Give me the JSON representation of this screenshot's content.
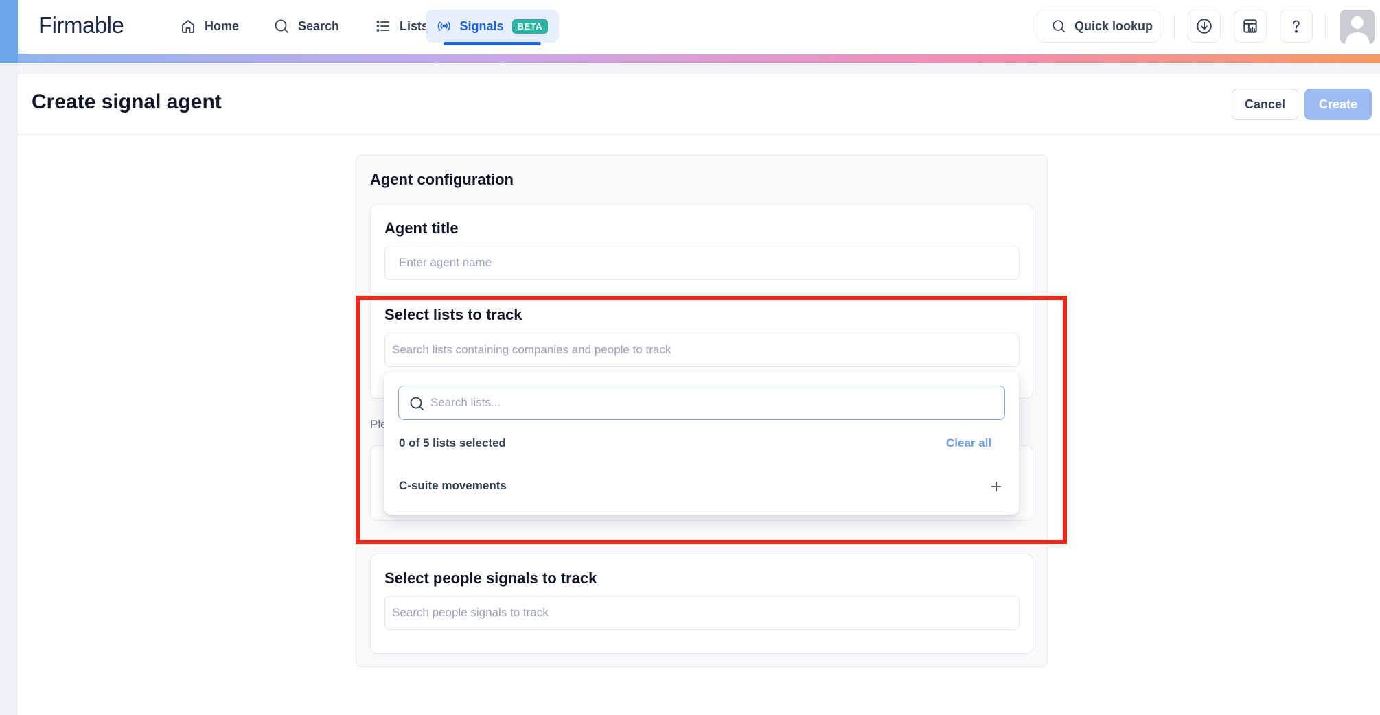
{
  "app": {
    "logo": "Firmable"
  },
  "nav": {
    "home": "Home",
    "search": "Search",
    "lists": "Lists",
    "signals": "Signals",
    "signals_badge": "BETA",
    "quick_lookup": "Quick lookup"
  },
  "header": {
    "title": "Create signal agent",
    "cancel": "Cancel",
    "create": "Create"
  },
  "config": {
    "title": "Agent configuration",
    "agent_title": {
      "label": "Agent title",
      "placeholder": "Enter agent name"
    },
    "lists": {
      "label": "Select lists to track",
      "placeholder": "Search lists containing companies and people to track"
    },
    "hint_partial": "Ple",
    "people_signals": {
      "label": "Select people signals to track",
      "placeholder": "Search people signals to track"
    }
  },
  "dropdown": {
    "search_placeholder": "Search lists...",
    "count": "0 of 5 lists selected",
    "clear_all": "Clear all",
    "items": [
      {
        "label": "C-suite movements"
      }
    ]
  },
  "colors": {
    "accent": "#1d64d8",
    "badge": "#2bb3a3",
    "create_disabled": "#9dbcf1",
    "highlight": "#f0261b"
  }
}
